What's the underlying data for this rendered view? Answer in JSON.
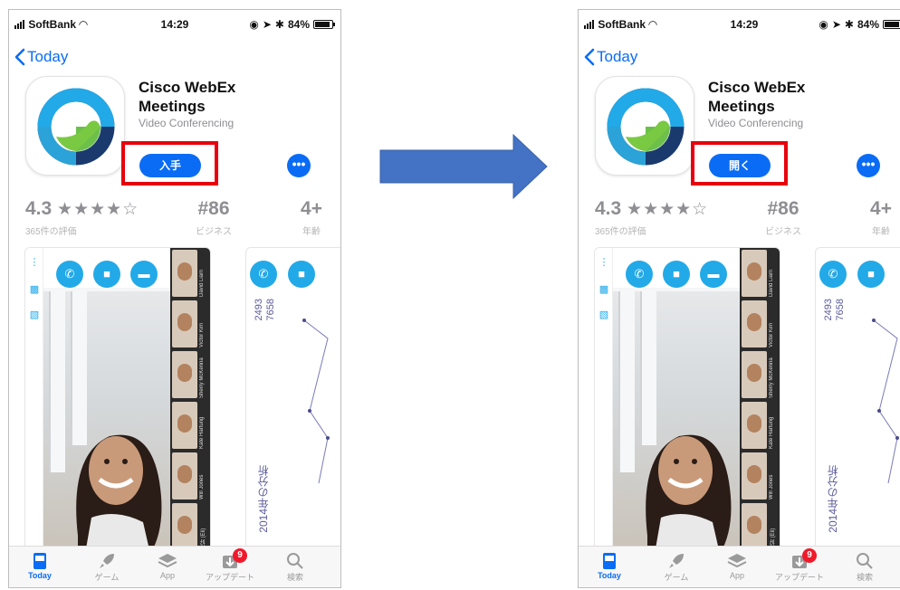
{
  "status_bar": {
    "carrier": "SoftBank",
    "time": "14:29",
    "battery": "84%"
  },
  "nav": {
    "back_label": "Today"
  },
  "app": {
    "name_line1": "Cisco WebEx",
    "name_line2": "Meetings",
    "category": "Video Conferencing"
  },
  "stats": {
    "rating": "4.3",
    "stars": "★★★★☆",
    "rating_count": "365件の評価",
    "rank": "#86",
    "rank_label": "ビジネス",
    "age": "4+",
    "age_label": "年齢"
  },
  "screenshots": {
    "participants": [
      "David Liam",
      "Victor Kim",
      "Sherry McKenna",
      "Kate Hartung",
      "Will Jones",
      "你好 (Eli)"
    ],
    "numbers_line1": "2493",
    "numbers_line2": "7658",
    "analysis_title": "2014年の分析"
  },
  "left_screen": {
    "action_button_label": "入手",
    "more_label": "•••"
  },
  "right_screen": {
    "action_button_label": "開く",
    "more_label": "•••"
  },
  "tabbar": {
    "items": [
      {
        "label": "Today",
        "icon": "today-icon"
      },
      {
        "label": "ゲーム",
        "icon": "rocket-icon"
      },
      {
        "label": "App",
        "icon": "layers-icon"
      },
      {
        "label": "アップデート",
        "icon": "download-icon"
      },
      {
        "label": "検索",
        "icon": "search-icon"
      }
    ],
    "update_badge": "9"
  },
  "colors": {
    "ios_blue": "#0a6cf5",
    "highlight_red": "#e8000d",
    "arrow_blue": "#4472c4",
    "webex_blue": "#22a9e8"
  }
}
